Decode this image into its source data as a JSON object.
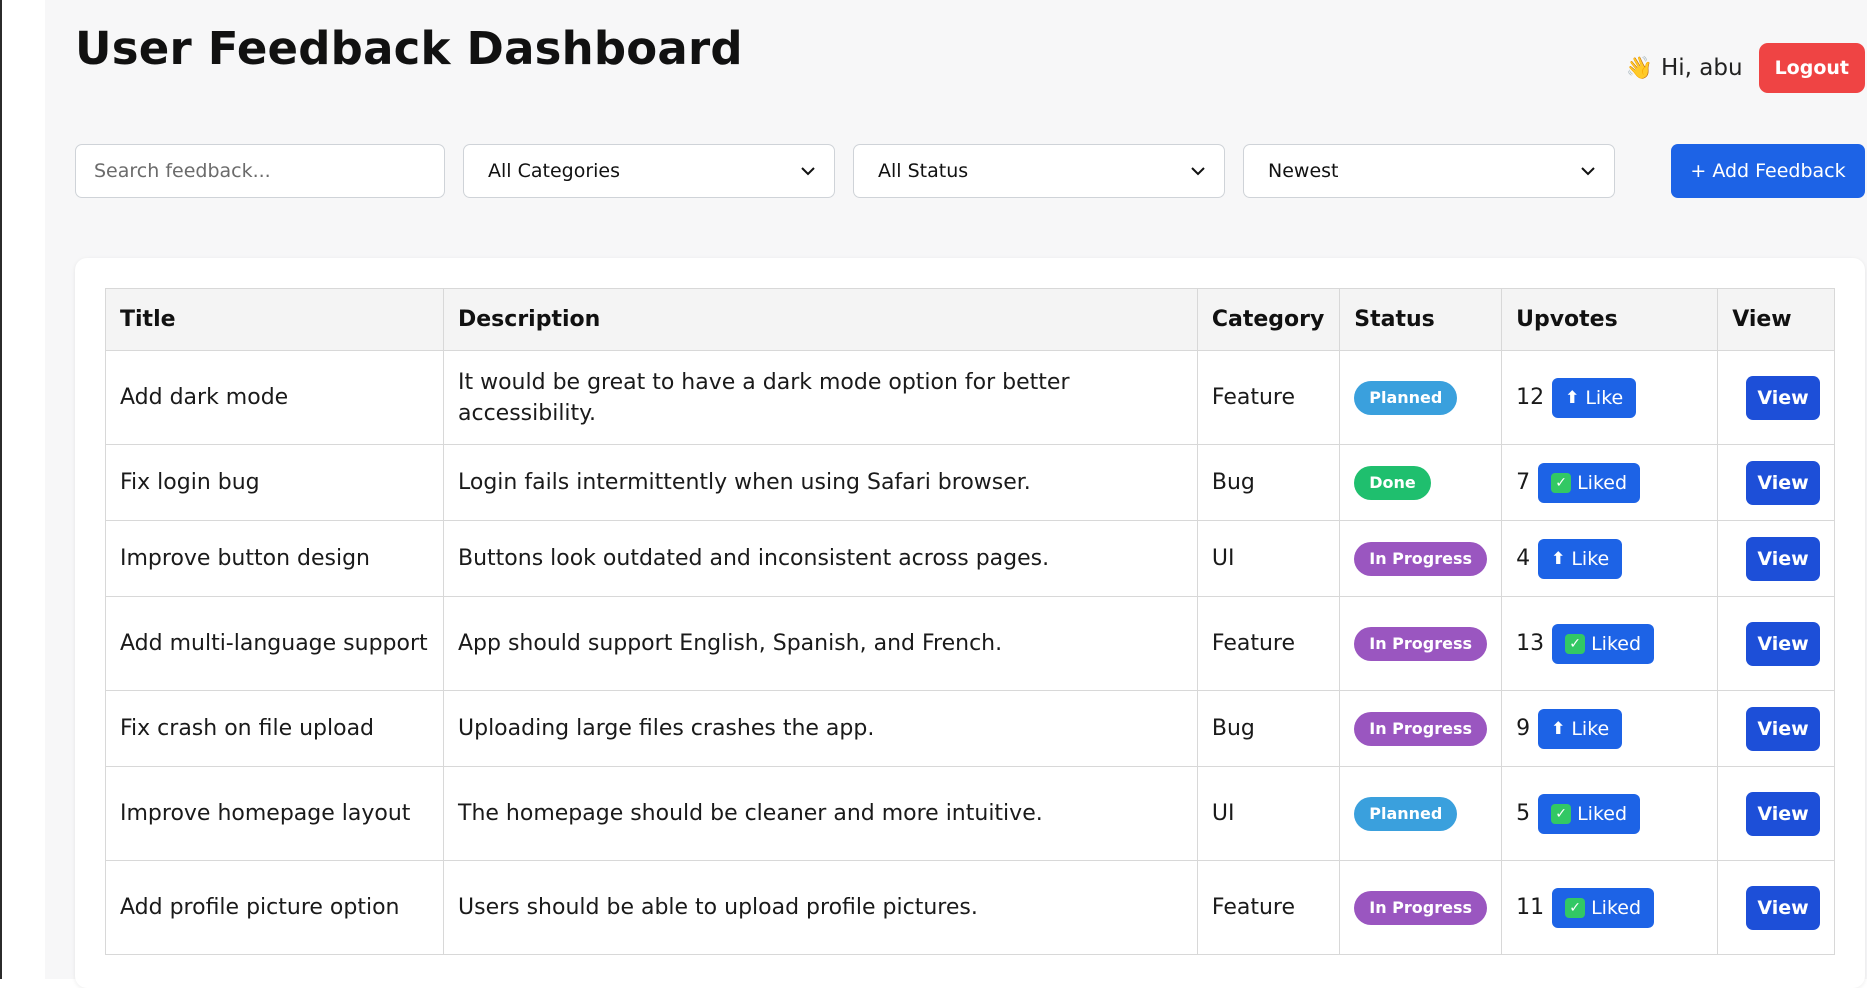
{
  "header": {
    "title": "User Feedback Dashboard",
    "greeting": "Hi, abu",
    "wave_icon": "👋",
    "logout_label": "Logout"
  },
  "filters": {
    "search_placeholder": "Search feedback...",
    "category": "All Categories",
    "status": "All Status",
    "sort": "Newest",
    "add_label": "+ Add Feedback"
  },
  "colors": {
    "primary": "#1d63e6",
    "logout": "#ef4444",
    "planned": "#3aa0dd",
    "done": "#1fbf6e",
    "in_progress": "#9a56c0"
  },
  "table": {
    "columns": {
      "title": "Title",
      "description": "Description",
      "category": "Category",
      "status": "Status",
      "upvotes": "Upvotes",
      "view": "View"
    },
    "rows": [
      {
        "title": "Add dark mode",
        "description": "It would be great to have a dark mode option for better accessibility.",
        "category": "Feature",
        "status": "Planned",
        "upvotes": "12",
        "like": "Like",
        "liked": false,
        "view": "View"
      },
      {
        "title": "Fix login bug",
        "description": "Login fails intermittently when using Safari browser.",
        "category": "Bug",
        "status": "Done",
        "upvotes": "7",
        "like": "Liked",
        "liked": true,
        "view": "View"
      },
      {
        "title": "Improve button design",
        "description": "Buttons look outdated and inconsistent across pages.",
        "category": "UI",
        "status": "In Progress",
        "upvotes": "4",
        "like": "Like",
        "liked": false,
        "view": "View"
      },
      {
        "title": "Add multi-language support",
        "description": "App should support English, Spanish, and French.",
        "category": "Feature",
        "status": "In Progress",
        "upvotes": "13",
        "like": "Liked",
        "liked": true,
        "view": "View"
      },
      {
        "title": "Fix crash on file upload",
        "description": "Uploading large files crashes the app.",
        "category": "Bug",
        "status": "In Progress",
        "upvotes": "9",
        "like": "Like",
        "liked": false,
        "view": "View"
      },
      {
        "title": "Improve homepage layout",
        "description": "The homepage should be cleaner and more intuitive.",
        "category": "UI",
        "status": "Planned",
        "upvotes": "5",
        "like": "Liked",
        "liked": true,
        "view": "View"
      },
      {
        "title": "Add profile picture option",
        "description": "Users should be able to upload profile pictures.",
        "category": "Feature",
        "status": "In Progress",
        "upvotes": "11",
        "like": "Liked",
        "liked": true,
        "view": "View"
      }
    ]
  }
}
